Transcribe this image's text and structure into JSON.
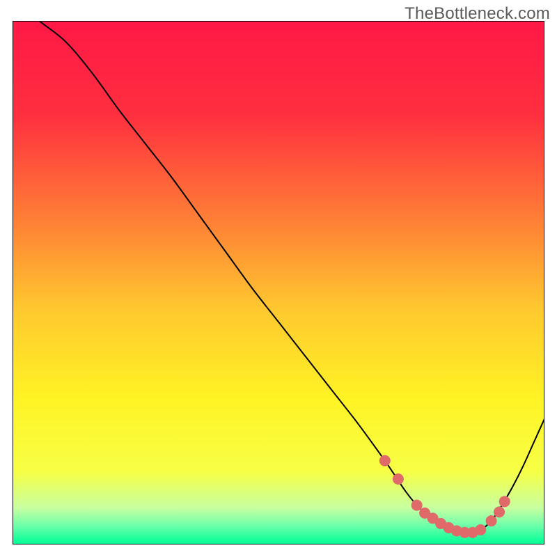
{
  "watermark": "TheBottleneck.com",
  "chart_data": {
    "type": "line",
    "title": "",
    "xlabel": "",
    "ylabel": "",
    "xlim": [
      0,
      100
    ],
    "ylim": [
      0,
      100
    ],
    "grid": false,
    "legend": false,
    "gradient_stops": [
      {
        "offset": 0.0,
        "color": "#ff1846"
      },
      {
        "offset": 0.18,
        "color": "#ff2f3f"
      },
      {
        "offset": 0.4,
        "color": "#ff8735"
      },
      {
        "offset": 0.55,
        "color": "#ffc82f"
      },
      {
        "offset": 0.72,
        "color": "#fff324"
      },
      {
        "offset": 0.86,
        "color": "#f7ff45"
      },
      {
        "offset": 0.93,
        "color": "#c8ffa0"
      },
      {
        "offset": 0.965,
        "color": "#6bffab"
      },
      {
        "offset": 0.99,
        "color": "#19ff9b"
      },
      {
        "offset": 1.0,
        "color": "#0aff93"
      }
    ],
    "series": [
      {
        "name": "bottleneck-curve",
        "color": "#000000",
        "stroke_width": 2,
        "x": [
          0,
          5,
          10,
          15,
          20,
          25,
          30,
          35,
          40,
          45,
          50,
          55,
          60,
          65,
          70,
          72,
          74,
          76,
          78,
          80,
          82,
          84,
          86,
          88,
          90,
          92,
          94,
          96,
          98,
          100
        ],
        "y": [
          104,
          100,
          96,
          90,
          83,
          76.5,
          70,
          63,
          56,
          49,
          42.5,
          36,
          29.5,
          23,
          16,
          13,
          10,
          7.5,
          5.5,
          4,
          3,
          2.3,
          2.2,
          2.8,
          4.5,
          7.5,
          11,
          15,
          19.5,
          24
        ]
      }
    ],
    "points": {
      "name": "highlight-dots",
      "color": "#e06a6a",
      "radius": 8,
      "x": [
        70,
        72.5,
        76,
        77.5,
        79,
        80.5,
        82,
        83.5,
        85,
        86.5,
        88,
        90,
        91.5,
        92.5
      ],
      "y": [
        16,
        12.5,
        7.5,
        6,
        5,
        4,
        3.2,
        2.6,
        2.3,
        2.3,
        2.8,
        4.5,
        6.2,
        8.2
      ]
    }
  }
}
